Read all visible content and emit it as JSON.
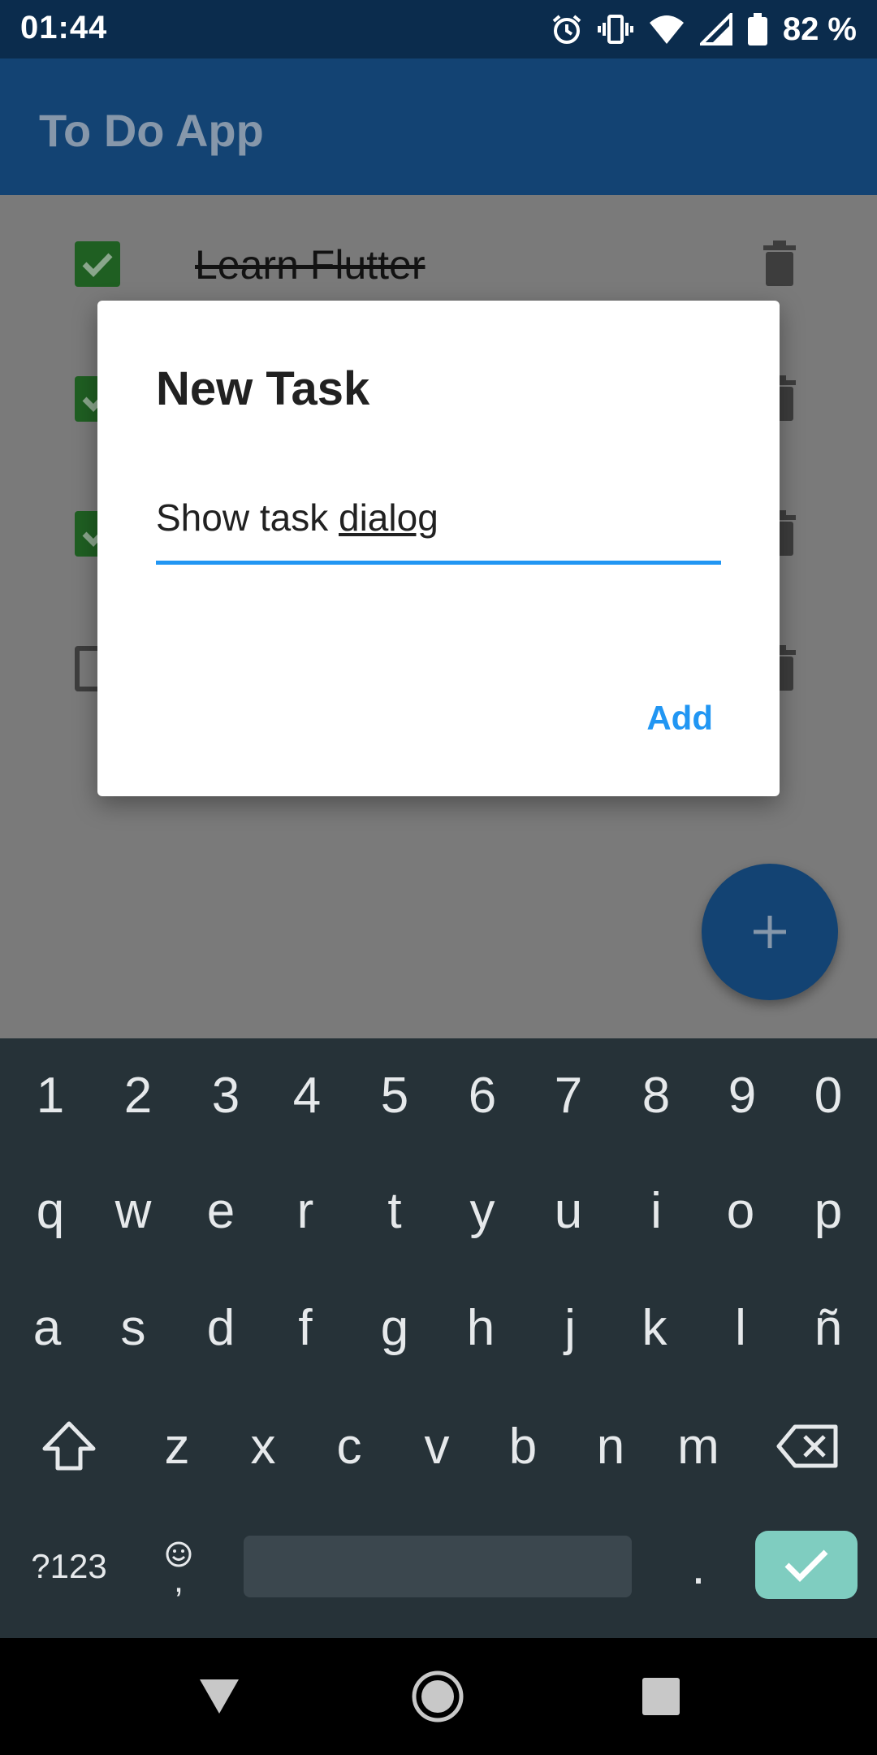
{
  "status_bar": {
    "time": "01:44",
    "battery": "82 %"
  },
  "app_bar": {
    "title": "To Do App"
  },
  "tasks": [
    {
      "label": "Learn Flutter",
      "done": true
    },
    {
      "label": "",
      "done": true
    },
    {
      "label": "",
      "done": true
    },
    {
      "label": "",
      "done": false
    }
  ],
  "dialog": {
    "title": "New Task",
    "input_value_plain": "Show task ",
    "input_value_composing": "dialog",
    "add_label": "Add"
  },
  "keyboard": {
    "number_row": [
      "1",
      "2",
      "3",
      "4",
      "5",
      "6",
      "7",
      "8",
      "9",
      "0"
    ],
    "row1": [
      "q",
      "w",
      "e",
      "r",
      "t",
      "y",
      "u",
      "i",
      "o",
      "p"
    ],
    "row2": [
      "a",
      "s",
      "d",
      "f",
      "g",
      "h",
      "j",
      "k",
      "l",
      "ñ"
    ],
    "row3": [
      "z",
      "x",
      "c",
      "v",
      "b",
      "n",
      "m"
    ],
    "symbols_label": "?123",
    "comma_label": ",",
    "period_label": "."
  },
  "colors": {
    "app_bar": "#134373",
    "accent": "#2196f3",
    "checkbox_checked": "#1f5f22",
    "keyboard_bg": "#263238",
    "enter_key": "#7fcdc0"
  },
  "icons": [
    "alarm-icon",
    "vibrate-icon",
    "wifi-icon",
    "signal-icon",
    "battery-icon",
    "trash-icon",
    "add-icon",
    "shift-icon",
    "backspace-icon",
    "emoji-icon",
    "check-icon",
    "nav-back-icon",
    "nav-home-icon",
    "nav-recents-icon"
  ]
}
